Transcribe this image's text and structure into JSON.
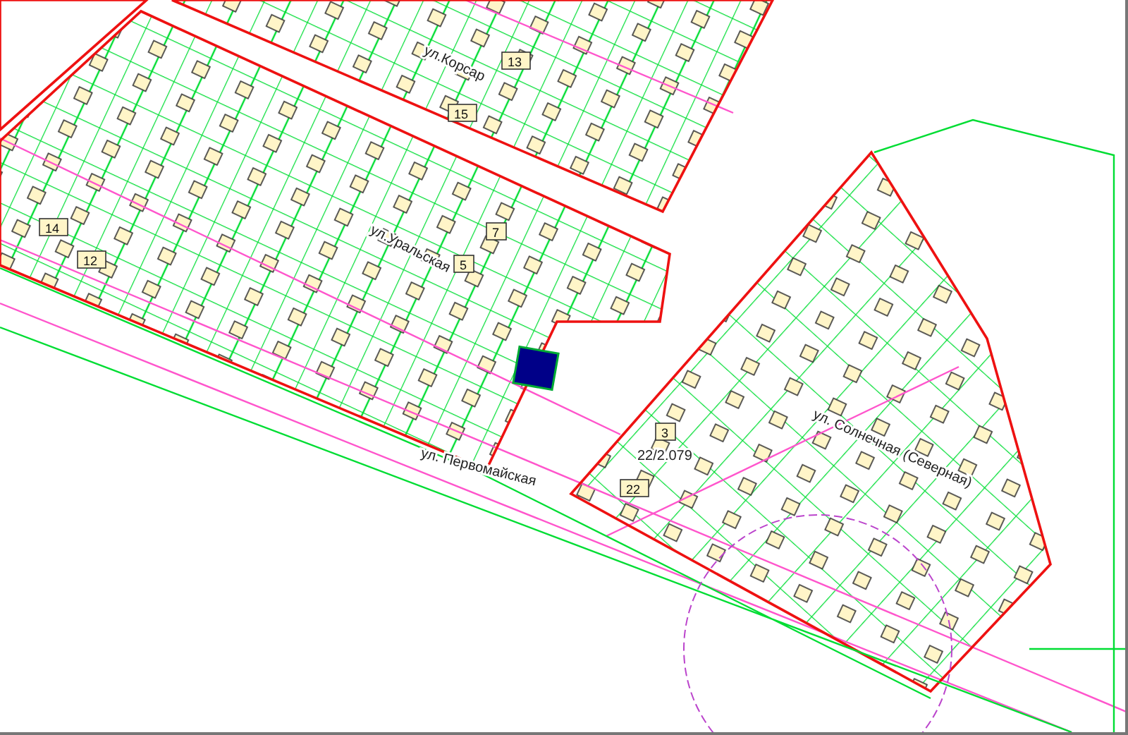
{
  "map": {
    "streets": [
      {
        "name": "ул.Корсар"
      },
      {
        "name": "ул.Уральская"
      },
      {
        "name": "ул. Первомайская"
      },
      {
        "name": "ул. Солнечная (Северная)"
      }
    ],
    "plot_label": "22/2.079",
    "lots": [
      {
        "number": "14"
      },
      {
        "number": "12"
      },
      {
        "number": "7"
      },
      {
        "number": "5"
      },
      {
        "number": "3"
      },
      {
        "number": "22"
      },
      {
        "number": "13"
      },
      {
        "number": "15"
      }
    ]
  }
}
